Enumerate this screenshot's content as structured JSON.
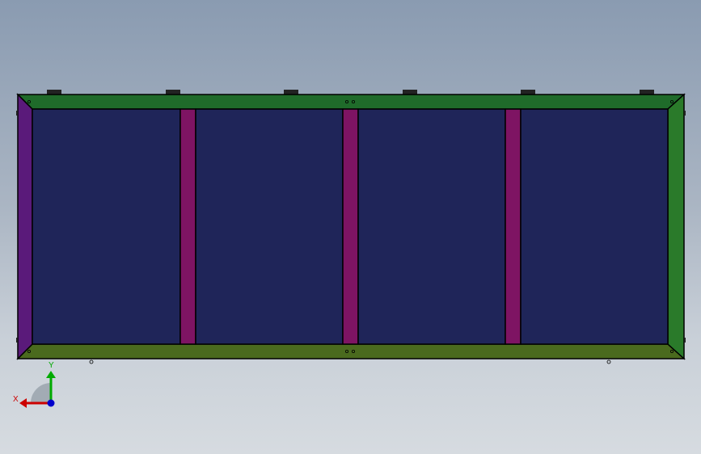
{
  "viewport": {
    "background_top": "#8a9bb1",
    "background_bottom": "#d6dbe0"
  },
  "model": {
    "frame_top_color": "#1f6b2a",
    "frame_bottom_color": "#4a6a1e",
    "frame_left_color": "#5a1a7a",
    "frame_right_color": "#2a7a2a",
    "panel_color": "#1f2559",
    "divider_color": "#7e1463",
    "outline_color": "#000000",
    "panel_count": 4,
    "divider_count": 3
  },
  "triad": {
    "x_label": "X",
    "y_label": "Y",
    "x_color": "#cc0000",
    "y_color": "#00aa00",
    "z_color": "#0000cc"
  }
}
